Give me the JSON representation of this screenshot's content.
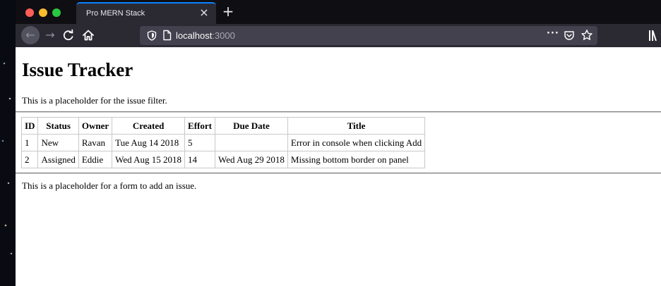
{
  "browser": {
    "tab_title": "Pro MERN Stack",
    "close_tab_glyph": "×",
    "new_tab_glyph": "+",
    "back_glyph": "←",
    "forward_glyph": "→",
    "url_host": "localhost",
    "url_port": ":3000",
    "more_glyph": "···",
    "icons": [
      "back-icon",
      "forward-icon",
      "reload-icon",
      "home-icon",
      "shield-icon",
      "page-icon",
      "more-icon",
      "pocket-icon",
      "bookmark-star-icon",
      "library-icon"
    ]
  },
  "page": {
    "title": "Issue Tracker",
    "filter_placeholder": "This is a placeholder for the issue filter.",
    "add_placeholder": "This is a placeholder for a form to add an issue."
  },
  "table": {
    "headers": [
      "ID",
      "Status",
      "Owner",
      "Created",
      "Effort",
      "Due Date",
      "Title"
    ],
    "rows": [
      [
        "1",
        "New",
        "Ravan",
        "Tue Aug 14 2018",
        "5",
        "",
        "Error in console when clicking Add"
      ],
      [
        "2",
        "Assigned",
        "Eddie",
        "Wed Aug 15 2018",
        "14",
        "Wed Aug 29 2018",
        "Missing bottom border on panel"
      ]
    ]
  },
  "colors": {
    "tab_accent": "#0a84ff",
    "close_red": "#ff5f57",
    "minimize_yellow": "#febc2e",
    "zoom_green": "#28c840"
  }
}
